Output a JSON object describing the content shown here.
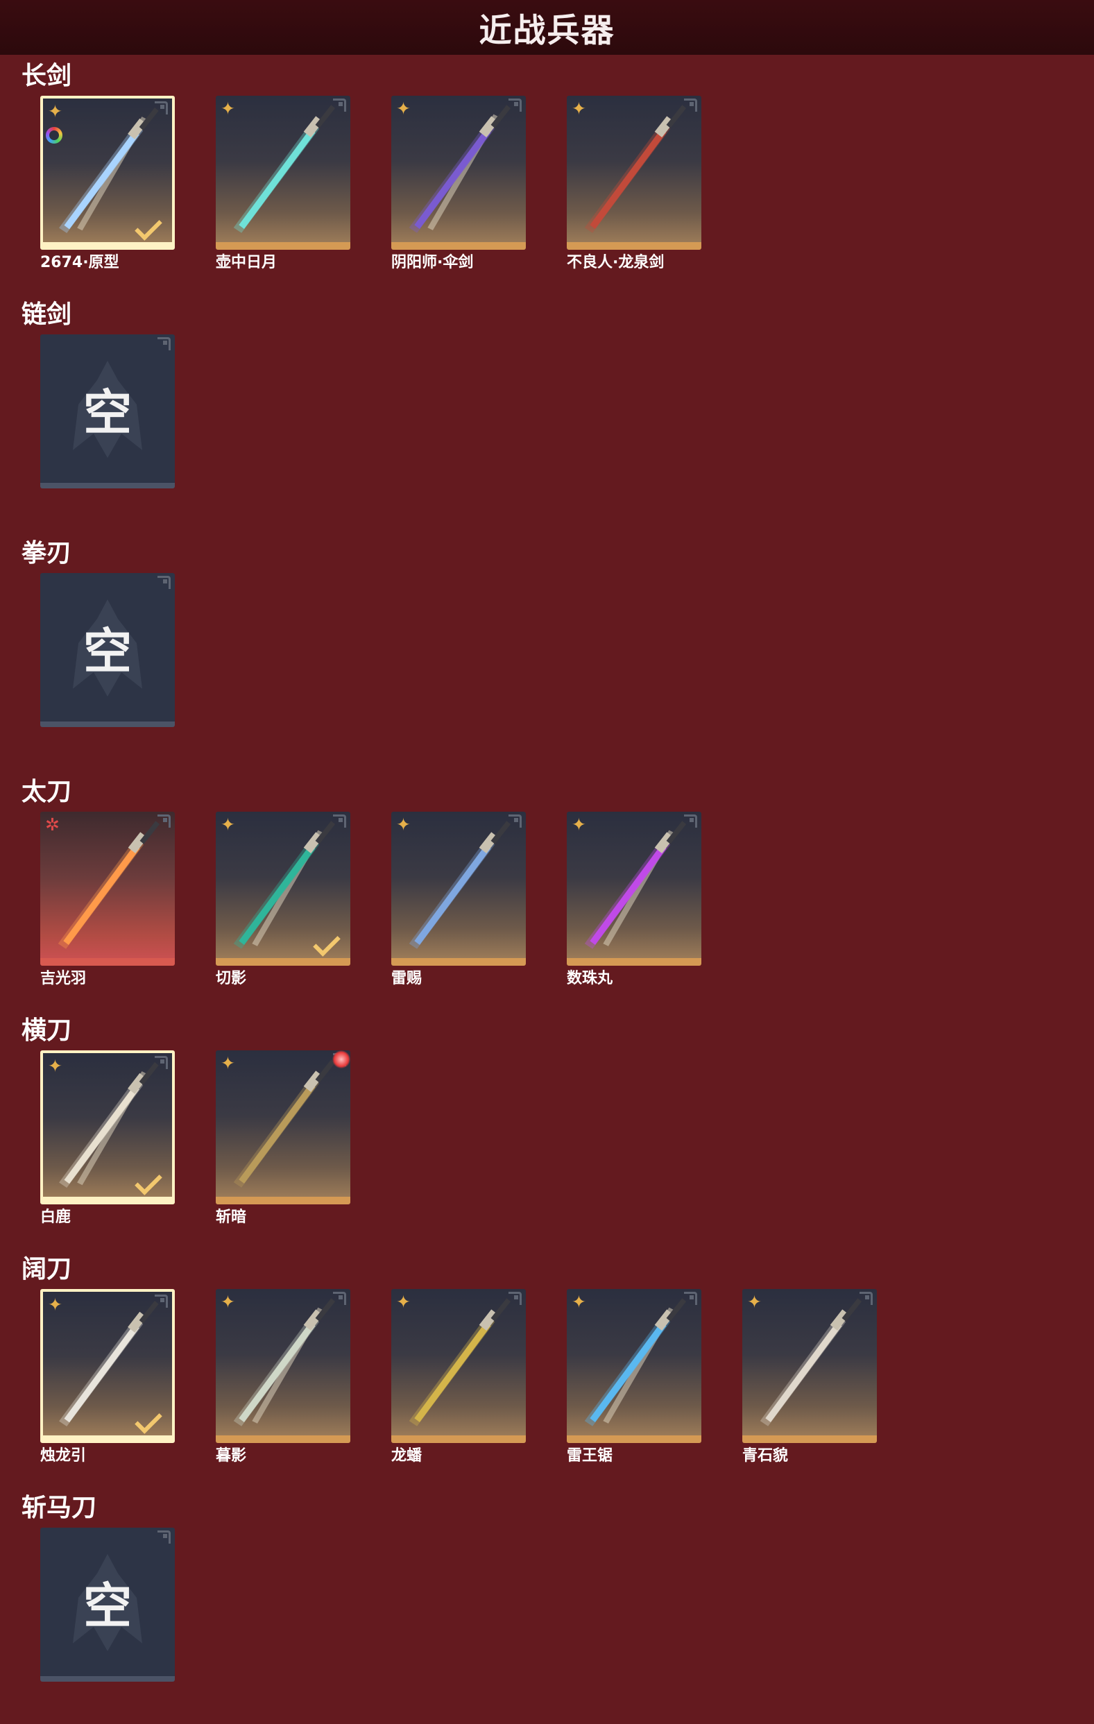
{
  "header": {
    "title": "近战兵器"
  },
  "empty_label": "空",
  "colors": {
    "background": "#641a1f",
    "header": "#310a0d",
    "accent_gold": "#d59a54",
    "selected_border": "#fff2c4"
  },
  "sections": [
    {
      "title": "长剑",
      "items": [
        {
          "name": "2674·原型",
          "selected": true,
          "badge": "star",
          "extra": "rainbow-ring",
          "theme": "normal",
          "color": "#a9d4ff"
        },
        {
          "name": "壶中日月",
          "selected": false,
          "badge": "star",
          "theme": "normal",
          "color": "#6fe1d8"
        },
        {
          "name": "阴阳师·伞剑",
          "selected": false,
          "badge": "star",
          "theme": "normal",
          "color": "#7a5bd0"
        },
        {
          "name": "不良人·龙泉剑",
          "selected": false,
          "badge": "star",
          "theme": "normal",
          "color": "#c24a3a"
        }
      ]
    },
    {
      "title": "链剑",
      "items": [
        {
          "empty": true
        }
      ]
    },
    {
      "title": "拳刃",
      "items": [
        {
          "empty": true
        }
      ]
    },
    {
      "title": "太刀",
      "items": [
        {
          "name": "吉光羽",
          "selected": false,
          "badge": "red-star",
          "theme": "red",
          "color": "#ff9a4a"
        },
        {
          "name": "切影",
          "selected": false,
          "badge": "star",
          "check": true,
          "theme": "normal",
          "color": "#2fb59a"
        },
        {
          "name": "雷赐",
          "selected": false,
          "badge": "star",
          "theme": "normal",
          "color": "#7fa7e0"
        },
        {
          "name": "数珠丸",
          "selected": false,
          "badge": "star",
          "theme": "normal",
          "color": "#c04ae8"
        }
      ]
    },
    {
      "title": "横刀",
      "items": [
        {
          "name": "白鹿",
          "selected": true,
          "badge": "star",
          "theme": "normal",
          "color": "#e8e0d0"
        },
        {
          "name": "斩暗",
          "selected": false,
          "badge": "star",
          "extra": "red-badge",
          "theme": "normal",
          "color": "#b99b5a"
        }
      ]
    },
    {
      "title": "阔刀",
      "items": [
        {
          "name": "烛龙引",
          "selected": true,
          "badge": "star",
          "theme": "normal",
          "color": "#e8e4dc"
        },
        {
          "name": "暮影",
          "selected": false,
          "badge": "star",
          "theme": "normal",
          "color": "#cfd8c8"
        },
        {
          "name": "龙蟠",
          "selected": false,
          "badge": "star",
          "theme": "normal",
          "color": "#d4b54a"
        },
        {
          "name": "雷王锯",
          "selected": false,
          "badge": "star",
          "theme": "normal",
          "color": "#5ab8f0"
        },
        {
          "name": "青石貌",
          "selected": false,
          "badge": "star",
          "theme": "normal",
          "color": "#e0d8cc"
        }
      ]
    },
    {
      "title": "斩马刀",
      "items": [
        {
          "empty": true
        }
      ]
    }
  ]
}
